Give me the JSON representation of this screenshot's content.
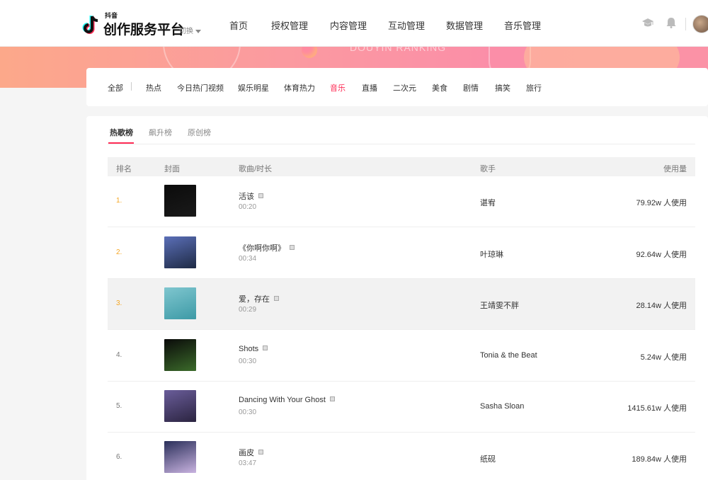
{
  "brand": {
    "small": "抖音",
    "big": "创作服务平台",
    "switch_label": "切换"
  },
  "nav": [
    "首页",
    "授权管理",
    "内容管理",
    "互动管理",
    "数据管理",
    "音乐管理"
  ],
  "icons": [
    "graduation-cap-icon",
    "bell-icon"
  ],
  "banner": {
    "text": "DOUYIN RANKING"
  },
  "categories": {
    "all": "全部",
    "items": [
      "热点",
      "今日热门视频",
      "娱乐明星",
      "体育热力",
      "音乐",
      "直播",
      "二次元",
      "美食",
      "剧情",
      "搞笑",
      "旅行"
    ],
    "active_index": 4
  },
  "subtabs": [
    "热歌榜",
    "飙升榜",
    "原创榜"
  ],
  "table": {
    "headers": [
      "排名",
      "封面",
      "歌曲/时长",
      "歌手",
      "使用量"
    ],
    "rows": [
      {
        "rank": "1.",
        "song": "活该",
        "duration": "00:20",
        "artist": "谌宥",
        "usage": "79.92w 人使用",
        "cover": [
          "#0b0b0b",
          "#1a1a1a"
        ]
      },
      {
        "rank": "2.",
        "song": "《你啊你啊》",
        "duration": "00:34",
        "artist": "叶琼琳",
        "usage": "92.64w 人使用",
        "cover": [
          "#5b6fb8",
          "#1e2a44"
        ]
      },
      {
        "rank": "3.",
        "song": "爱，存在",
        "duration": "00:29",
        "artist": "王靖雯不胖",
        "usage": "28.14w 人使用",
        "cover": [
          "#7fc6cf",
          "#3d9aa6"
        ]
      },
      {
        "rank": "4.",
        "song": "Shots",
        "duration": "00:30",
        "artist": "Tonia & the Beat",
        "usage": "5.24w 人使用",
        "cover": [
          "#0a0a0a",
          "#3b6b2a"
        ]
      },
      {
        "rank": "5.",
        "song": "Dancing With Your Ghost",
        "duration": "00:30",
        "artist": "Sasha Sloan",
        "usage": "1415.61w 人使用",
        "cover": [
          "#6a5d9a",
          "#2b2440"
        ]
      },
      {
        "rank": "6.",
        "song": "画皮",
        "duration": "03:47",
        "artist": "纸砚",
        "usage": "189.84w 人使用",
        "cover": [
          "#2a2f5a",
          "#c9b3e0"
        ]
      }
    ]
  },
  "colors": {
    "accent": "#fe2c55",
    "rank_top": "#f5a623"
  }
}
